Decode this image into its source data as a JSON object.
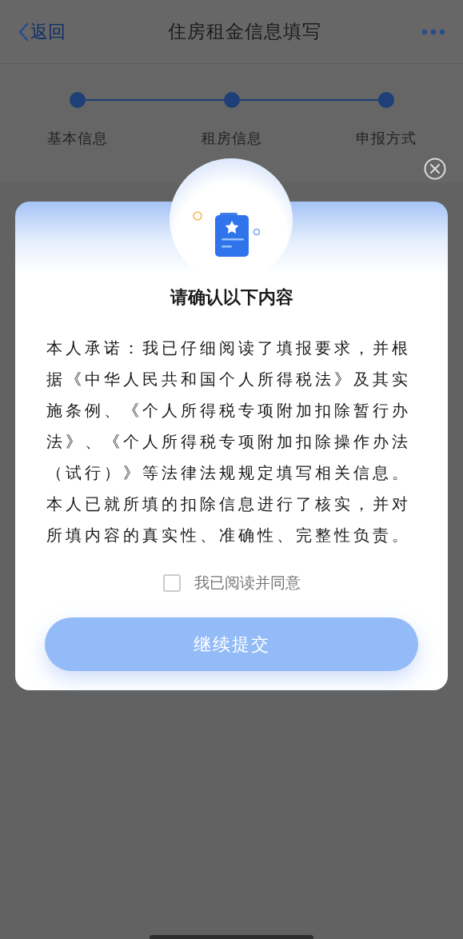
{
  "nav": {
    "back": "返回",
    "title": "住房租金信息填写"
  },
  "steps": [
    {
      "label": "基本信息",
      "done": true
    },
    {
      "label": "租房信息",
      "done": true
    },
    {
      "label": "申报方式",
      "done": true
    }
  ],
  "dialog": {
    "title": "请确认以下内容",
    "body": "本人承诺：我已仔细阅读了填报要求，并根据《中华人民共和国个人所得税法》及其实施条例、《个人所得税专项附加扣除暂行办法》、《个人所得税专项附加扣除操作办法（试行）》等法律法规规定填写相关信息。本人已就所填的扣除信息进行了核实，并对所填内容的真实性、准确性、完整性负责。",
    "agree": {
      "label": "我已阅读并同意",
      "checked": false
    },
    "submit": {
      "label": "继续提交",
      "disabled": true
    }
  }
}
